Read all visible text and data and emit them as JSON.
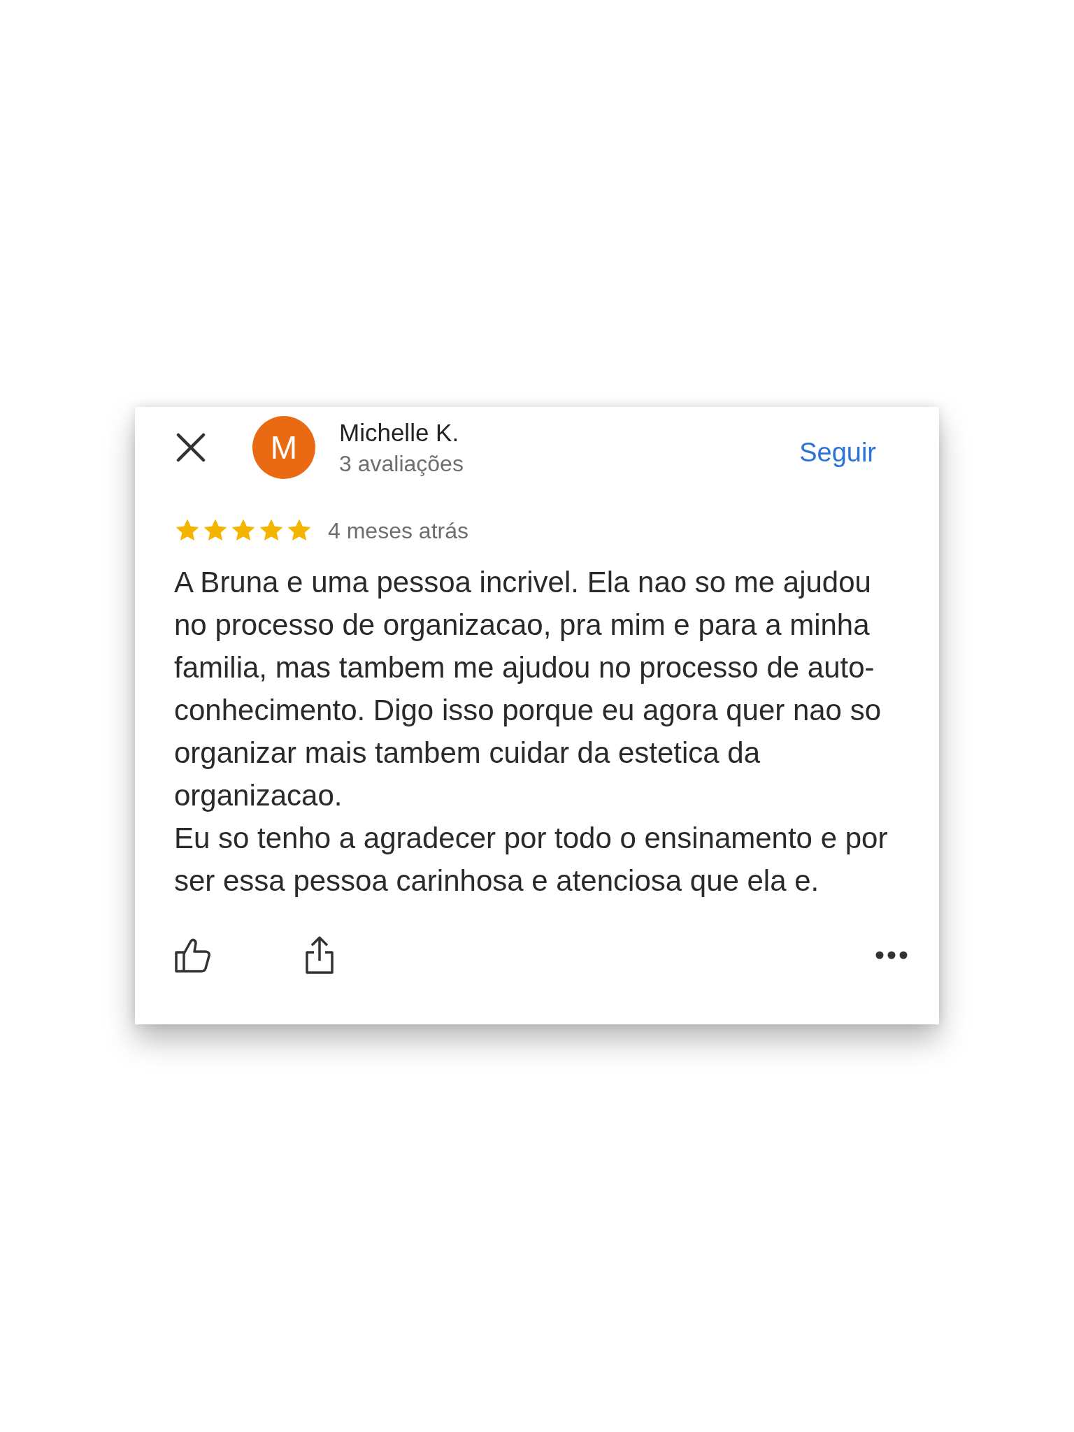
{
  "review": {
    "author": {
      "initial": "M",
      "name": "Michelle K.",
      "reviews_count": "3 avaliações"
    },
    "follow_button": "Seguir",
    "stars": 5,
    "time": "4 meses atrás",
    "paragraphs": [
      "A Bruna e uma pessoa incrivel. Ela nao so me ajudou no processo de organizacao, pra mim e para a minha familia, mas tambem me ajudou no processo de auto-conhecimento. Digo isso porque eu agora quer nao so organizar mais tambem cuidar da estetica da organizacao.",
      "Eu so tenho a agradecer por todo o ensinamento e por ser essa pessoa carinhosa e atenciosa que ela e."
    ]
  }
}
